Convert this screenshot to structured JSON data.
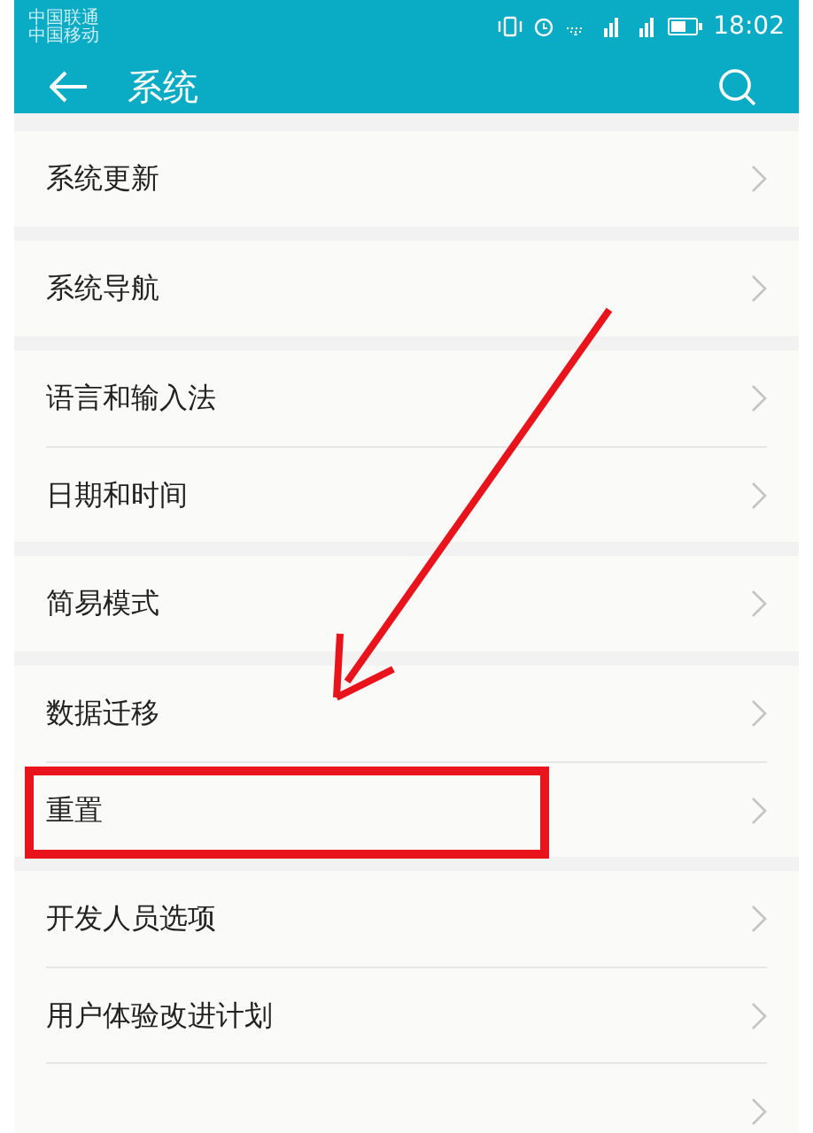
{
  "status_bar": {
    "carriers": [
      "中国联通",
      "中国移动"
    ],
    "time": "18:02"
  },
  "header": {
    "title": "系统"
  },
  "groups": [
    {
      "items": [
        {
          "label": "系统更新",
          "highlighted": false
        }
      ]
    },
    {
      "items": [
        {
          "label": "系统导航",
          "highlighted": false
        }
      ]
    },
    {
      "items": [
        {
          "label": "语言和输入法",
          "highlighted": false
        },
        {
          "label": "日期和时间",
          "highlighted": false
        }
      ]
    },
    {
      "items": [
        {
          "label": "简易模式",
          "highlighted": false
        }
      ]
    },
    {
      "items": [
        {
          "label": "数据迁移",
          "highlighted": false
        },
        {
          "label": "重置",
          "highlighted": true
        }
      ]
    },
    {
      "items": [
        {
          "label": "开发人员选项",
          "highlighted": false
        },
        {
          "label": "用户体验改进计划",
          "highlighted": false
        },
        {
          "highlighted": false
        }
      ]
    }
  ]
}
